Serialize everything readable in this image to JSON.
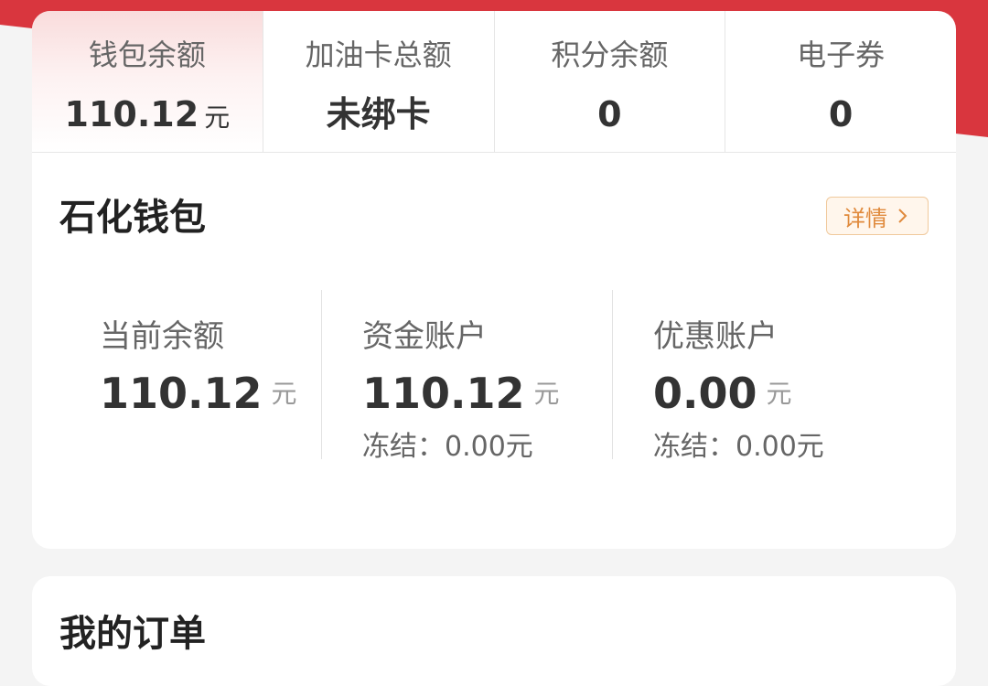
{
  "summary": {
    "items": [
      {
        "label": "钱包余额",
        "value": "110.12",
        "unit": "元"
      },
      {
        "label": "加油卡总额",
        "value": "未绑卡"
      },
      {
        "label": "积分余额",
        "value": "0"
      },
      {
        "label": "电子券",
        "value": "0"
      }
    ]
  },
  "wallet": {
    "title": "石化钱包",
    "detail_label": "详情",
    "accounts": [
      {
        "label": "当前余额",
        "value": "110.12",
        "unit": "元"
      },
      {
        "label": "资金账户",
        "value": "110.12",
        "unit": "元",
        "frozen": "冻结：0.00元"
      },
      {
        "label": "优惠账户",
        "value": "0.00",
        "unit": "元",
        "frozen": "冻结：0.00元"
      }
    ]
  },
  "orders": {
    "title": "我的订单"
  },
  "colors": {
    "brand_red": "#d9363e",
    "detail_orange": "#e08a3c"
  }
}
